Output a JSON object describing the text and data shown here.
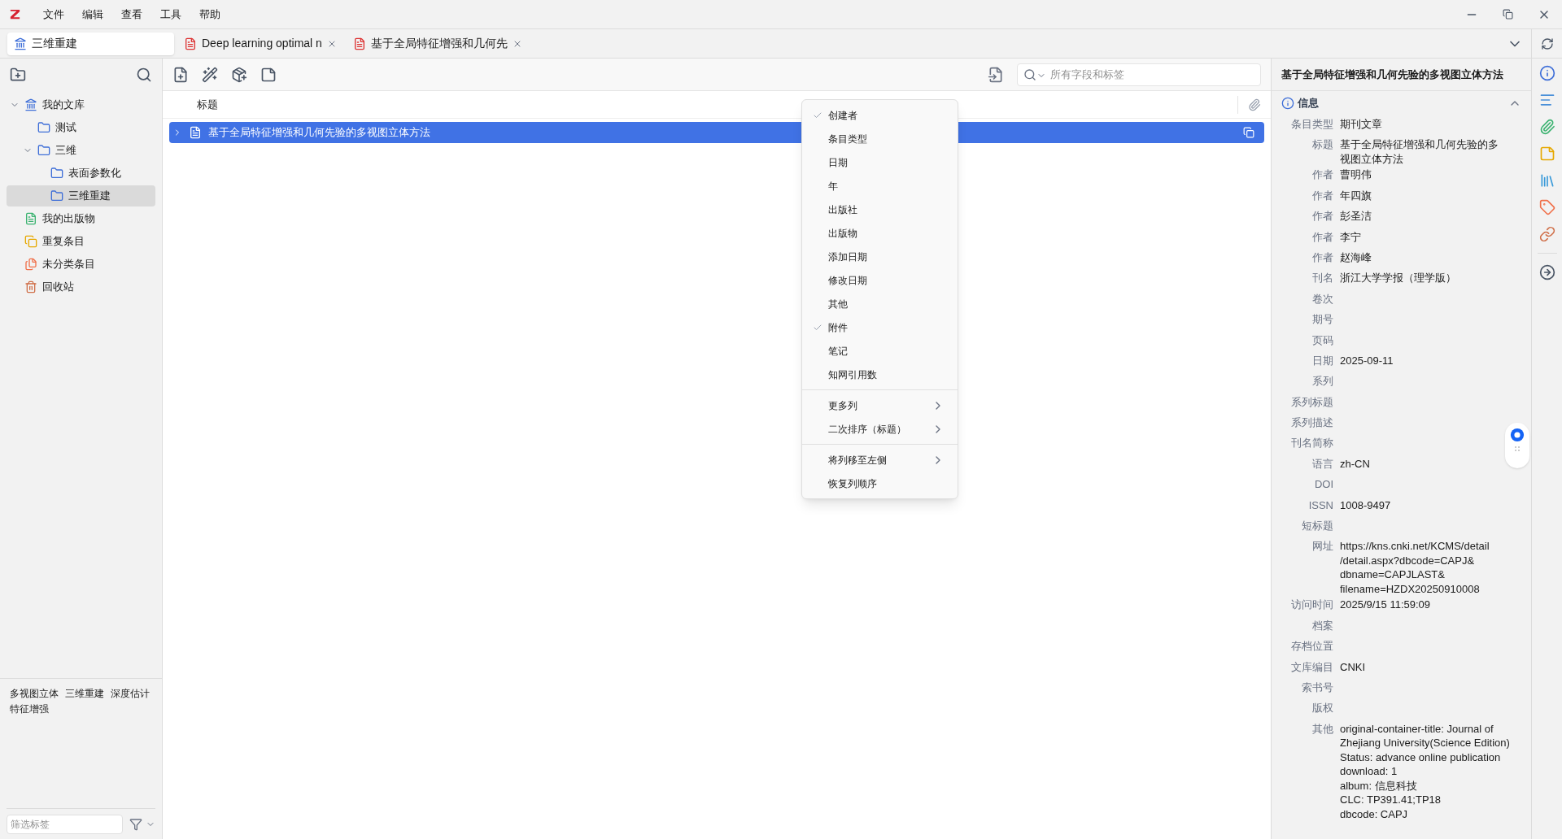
{
  "menu_bar": [
    "文件",
    "编辑",
    "查看",
    "工具",
    "帮助"
  ],
  "tabs": [
    {
      "label": "三维重建",
      "kind": "library",
      "selected": true
    },
    {
      "label": "Deep learning optimal n",
      "kind": "pdf",
      "selected": false
    },
    {
      "label": "基于全局特征增强和几何先",
      "kind": "pdf",
      "selected": false
    }
  ],
  "collections": [
    {
      "label": "我的文库",
      "kind": "library",
      "selected": false,
      "expanded": true,
      "children": [
        {
          "label": "测试",
          "kind": "folder",
          "selected": false
        },
        {
          "label": "三维",
          "kind": "folder",
          "selected": false,
          "expanded": true,
          "children": [
            {
              "label": "表面参数化",
              "kind": "folder",
              "selected": false
            },
            {
              "label": "三维重建",
              "kind": "folder",
              "selected": true
            }
          ]
        }
      ]
    },
    {
      "label": "我的出版物",
      "kind": "publications",
      "selected": false
    },
    {
      "label": "重复条目",
      "kind": "duplicates",
      "selected": false
    },
    {
      "label": "未分类条目",
      "kind": "unfiled",
      "selected": false
    },
    {
      "label": "回收站",
      "kind": "trash",
      "selected": false
    }
  ],
  "tags": [
    "多视图立体",
    "三维重建",
    "深度估计",
    "特征增强"
  ],
  "tag_filter": {
    "placeholder": "筛选标签"
  },
  "search": {
    "placeholder": "所有字段和标签"
  },
  "table": {
    "columns": [
      "标题"
    ],
    "rows": [
      {
        "title": "基于全局特征增强和几何先验的多视图立体方法",
        "selected": true
      }
    ]
  },
  "context_menu": [
    [
      {
        "label": "创建者",
        "checked": true
      },
      {
        "label": "条目类型",
        "checked": false
      },
      {
        "label": "日期",
        "checked": false
      },
      {
        "label": "年",
        "checked": false
      },
      {
        "label": "出版社",
        "checked": false
      },
      {
        "label": "出版物",
        "checked": false
      },
      {
        "label": "添加日期",
        "checked": false
      },
      {
        "label": "修改日期",
        "checked": false
      },
      {
        "label": "其他",
        "checked": false
      },
      {
        "label": "附件",
        "checked": true
      },
      {
        "label": "笔记",
        "checked": false
      },
      {
        "label": "知网引用数",
        "checked": false
      }
    ],
    [
      {
        "label": "更多列",
        "submenu": true
      },
      {
        "label": "二次排序（标题）",
        "submenu": true
      }
    ],
    [
      {
        "label": "将列移至左侧",
        "submenu": true
      },
      {
        "label": "恢复列顺序",
        "submenu": false
      }
    ]
  ],
  "item_pane": {
    "header": "基于全局特征增强和几何先验的多视图立体方法",
    "section": "信息",
    "fields": [
      {
        "label": "条目类型",
        "lines": [
          "期刊文章"
        ]
      },
      {
        "label": "标题",
        "lines": [
          "基于全局特征增强和几何先验的多",
          "视图立体方法"
        ]
      },
      {
        "label": "作者",
        "lines": [
          "曹明伟"
        ]
      },
      {
        "label": "作者",
        "lines": [
          "年四旗"
        ]
      },
      {
        "label": "作者",
        "lines": [
          "彭圣洁"
        ]
      },
      {
        "label": "作者",
        "lines": [
          "李宁"
        ]
      },
      {
        "label": "作者",
        "lines": [
          "赵海峰"
        ]
      },
      {
        "label": "刊名",
        "lines": [
          "浙江大学学报（理学版）"
        ]
      },
      {
        "label": "卷次"
      },
      {
        "label": "期号"
      },
      {
        "label": "页码"
      },
      {
        "label": "日期",
        "lines": [
          "2025-09-11"
        ]
      },
      {
        "label": "系列"
      },
      {
        "label": "系列标题"
      },
      {
        "label": "系列描述"
      },
      {
        "label": "刊名简称"
      },
      {
        "label": "语言",
        "lines": [
          "zh-CN"
        ]
      },
      {
        "label": "DOI"
      },
      {
        "label": "ISSN",
        "lines": [
          "1008-9497"
        ]
      },
      {
        "label": "短标题"
      },
      {
        "label": "网址",
        "lines": [
          "https://kns.cnki.net/KCMS/detail",
          "/detail.aspx?dbcode=CAPJ&",
          "dbname=CAPJLAST&",
          "filename=HZDX20250910008"
        ]
      },
      {
        "label": "访问时间",
        "lines": [
          "2025/9/15 11:59:09"
        ]
      },
      {
        "label": "档案"
      },
      {
        "label": "存档位置"
      },
      {
        "label": "文库编目",
        "lines": [
          "CNKI"
        ]
      },
      {
        "label": "索书号"
      },
      {
        "label": "版权"
      },
      {
        "label": "其他",
        "lines": [
          "original-container-title: Journal of",
          "Zhejiang University(Science Edition)",
          "Status: advance online publication",
          "download: 1",
          "album: 信息科技",
          "CLC: TP391.41;TP18",
          "dbcode: CAPJ"
        ]
      }
    ]
  }
}
